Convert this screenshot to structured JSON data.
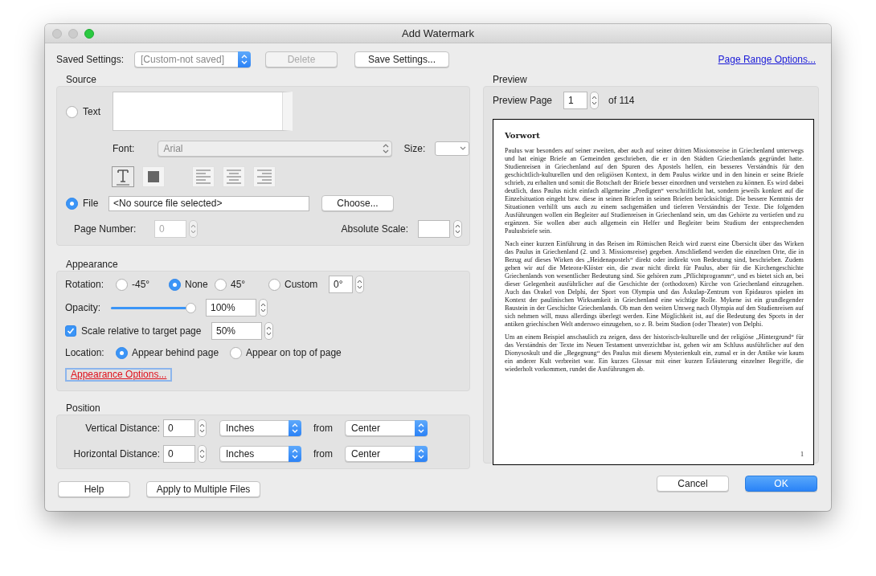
{
  "window": {
    "title": "Add Watermark"
  },
  "saved_settings": {
    "label": "Saved Settings:",
    "value": "[Custom-not saved]",
    "delete_button": {
      "label": "Delete",
      "disabled": true
    },
    "save_button": "Save Settings...",
    "page_range_link": "Page Range Options..."
  },
  "source": {
    "title": "Source",
    "text_option": {
      "label": "Text",
      "selected": false
    },
    "font_label": "Font:",
    "font_value": "Arial",
    "size_label": "Size:",
    "format_buttons": [
      {
        "kind": "text",
        "selected": true
      },
      {
        "kind": "fill",
        "selected": false
      },
      {
        "kind": "align-left",
        "selected": false
      },
      {
        "kind": "align-center",
        "selected": false
      },
      {
        "kind": "align-right",
        "selected": false
      }
    ],
    "file_option": {
      "label": "File",
      "selected": true
    },
    "file_value": "<No source file selected>",
    "choose_button": "Choose...",
    "page_number_label": "Page Number:",
    "page_number_value": "0",
    "absolute_scale_label": "Absolute Scale:"
  },
  "appearance": {
    "title": "Appearance",
    "rotation_label": "Rotation:",
    "rotation_options": [
      {
        "label": "-45°",
        "selected": false
      },
      {
        "label": "None",
        "selected": true
      },
      {
        "label": "45°",
        "selected": false
      },
      {
        "label": "Custom",
        "selected": false
      }
    ],
    "rotation_value": "0°",
    "opacity_label": "Opacity:",
    "opacity": {
      "level": 1
    },
    "opacity_value": "100%",
    "scale": {
      "label": "Scale relative to target page",
      "checked": true
    },
    "scale_value": "50%",
    "location_label": "Location:",
    "location_options": [
      {
        "label": "Appear behind page",
        "selected": true
      },
      {
        "label": "Appear on top of page",
        "selected": false
      }
    ],
    "options_link": "Appearance Options..."
  },
  "position": {
    "title": "Position",
    "rows": [
      {
        "label": "Vertical Distance:",
        "value": "0",
        "unit": "Inches",
        "from": "from",
        "reference": "Center"
      },
      {
        "label": "Horizontal Distance:",
        "value": "0",
        "unit": "Inches",
        "from": "from",
        "reference": "Center"
      }
    ]
  },
  "preview": {
    "title": "Preview",
    "page_label": "Preview Page",
    "page_value": "1",
    "page_count": "of 114",
    "document": {
      "heading": "Vorwort",
      "paragraphs": [
        "Paulus war besonders auf seiner zweiten, aber auch auf seiner dritten Missionsreise in Griechenland unterwegs und hat einige Briefe an Gemeinden geschrieben, die er in den Städten Griechenlands gegründet hatte. Studienreisen in Griechenland auf den Spuren des Apostels helfen, ein besseres Verständnis für den geschichtlich-kulturellen und den religiösen Kontext, in dem Paulus wirkte und in den hinein er seine Briefe schrieb, zu erhalten und somit die Botschaft der Briefe besser einordnen und verstehen zu können. Es wird dabei deutlich, dass Paulus nicht einfach allgemeine „Predigten“ verschriftlicht hat, sondern jeweils konkret auf die Einzelsituation eingeht bzw. diese in seinen Briefen in seinen Briefen berücksichtigt. Die bessere Kenntnis der Situationen verhilft uns auch zu einem sachgemäßen und tieferen Verständnis der Texte. Die folgenden Ausführungen wollen ein Begleiter auf Studienreisen in Griechenland sein, um das Gehörte zu vertiefen und zu ergänzen. Sie wollen aber auch allgemein ein Helfer und Begleiter beim Studium der entsprechenden Paulusbriefe sein.",
        "Nach einer kurzen Einführung in das Reisen im Römischen Reich wird zuerst eine Übersicht über das Wirken das Paulus in Griechenland (2. und 3. Missionsreise) gegeben. Anschließend werden die einzelnen Orte, die in Bezug auf dieses Wirken des „Heidenapostels“ direkt oder indirekt von Bedeutung sind, beschrieben. Zudem gehen wir auf die Meteora-Klöster ein, die zwar nicht direkt für Paulus, aber für die Kirchengeschichte Griechenlands von wesentlicher Bedeutung sind. Sie gehören zum „Pflichtprogramm“, und es bietet sich an, bei dieser Gelegenheit ausführlicher auf die Geschichte der (orthodoxen) Kirche von Griechenland einzugehen. Auch das Orakel von Delphi, der Sport von Olympia und das Äskulap-Zentrum von Epidauros spielen im Kontext der paulinischen Wirksamkeit in Griechenland eine wichtige Rolle. Mykene ist ein grundlegender Baustein in der Geschichte Griechenlands. Ob man den weiten Umweg nach Olympia auf den Studienreisen auf sich nehmen will, muss allerdings überlegt werden. Eine Möglichkeit ist, auf die Bedeutung des Sports in der antiken griechischen Welt anderswo einzugehen, so z. B. beim Stadion (oder Theater) von Delphi.",
        "Um an einem Beispiel anschaulich zu zeigen, dass der historisch-kulturelle und der religiöse „Hintergrund“ für das Verständnis der Texte im Neuen Testament unverzichtbar ist, gehen wir am Schluss ausführlicher auf den Dionysoskult und die „Begegnung“ des Paulus mit diesem Mysterienkult ein, zumal er in der Antike wie kaum ein anderer Kult verbreitet war. Ein kurzes Glossar mit einer kurzen Erläuterung einzelner Begriffe, die wiederholt vorkommen, rundet die Ausführungen ab."
      ],
      "page_number": "1"
    }
  },
  "footer_buttons": [
    {
      "label": "Help",
      "default": false
    },
    {
      "label": "Apply to Multiple Files",
      "default": false
    },
    {
      "label": "Cancel",
      "default": false
    },
    {
      "label": "OK",
      "default": true
    }
  ]
}
